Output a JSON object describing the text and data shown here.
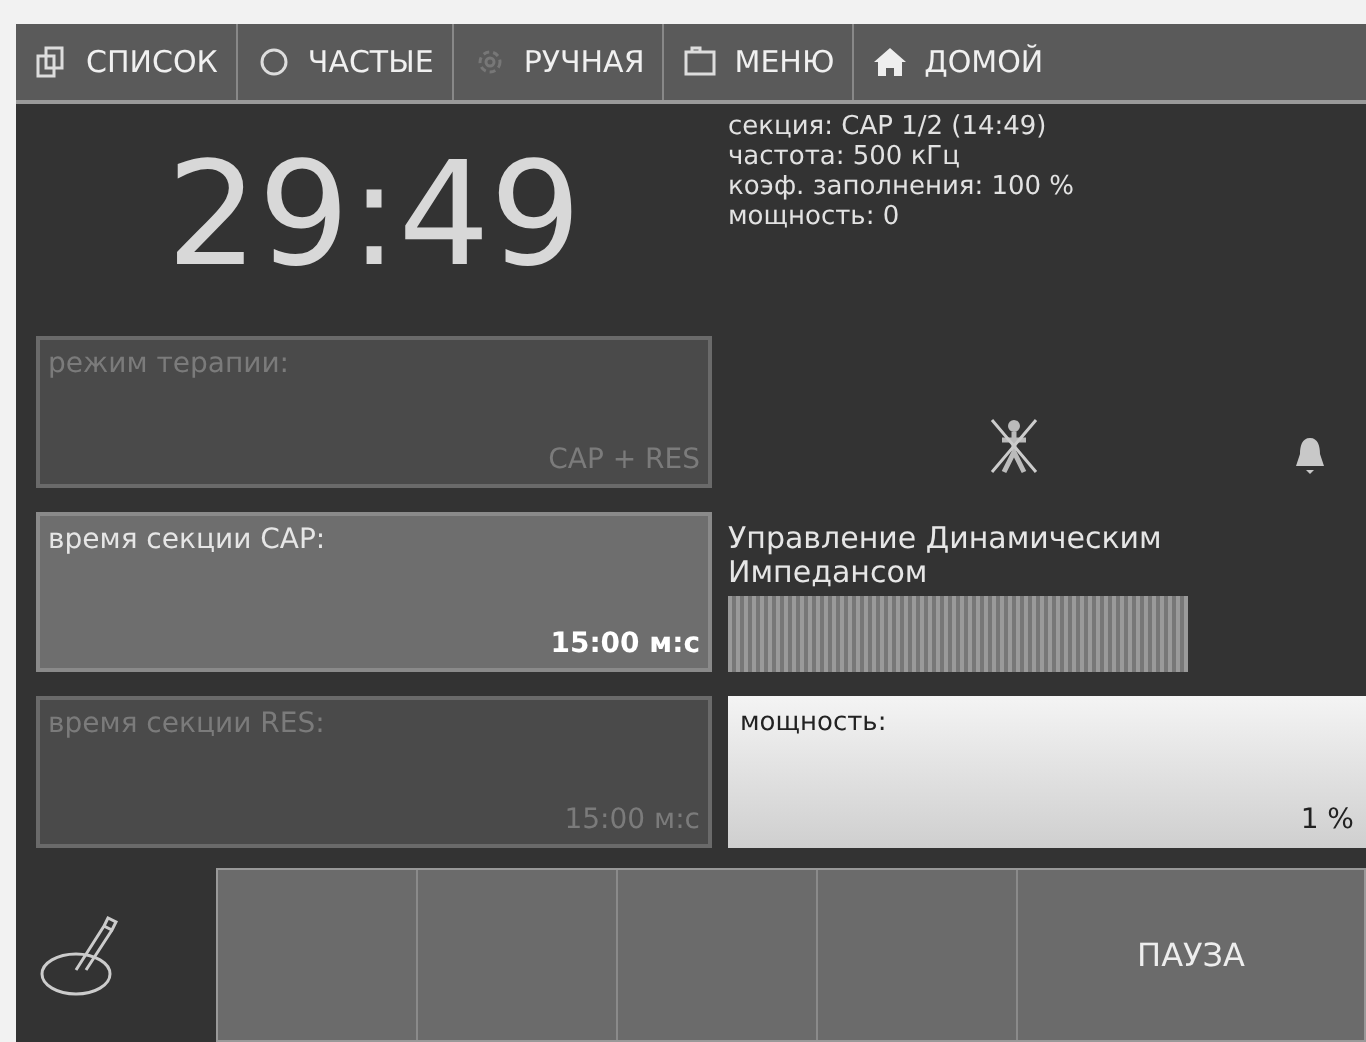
{
  "toolbar": [
    {
      "label": "СПИСОК",
      "kind": "list"
    },
    {
      "label": "ЧАСТЫЕ",
      "kind": "favorites"
    },
    {
      "label": "РУЧНАЯ",
      "kind": "manual"
    },
    {
      "label": "МЕНЮ",
      "kind": "menu"
    },
    {
      "label": "ДОМОЙ",
      "kind": "home"
    }
  ],
  "timer": "29:49",
  "info": [
    "секция: CAP 1/2 (14:49)",
    "частота: 500 кГц",
    "коэф. заполнения: 100 %",
    "мощность: 0"
  ],
  "panels": [
    {
      "label": "режим терапии:",
      "value": "CAP + RES",
      "disabled": true
    },
    {
      "label": "время секции CAP:",
      "value": "15:00 м:с",
      "disabled": false
    },
    {
      "label": "время секции RES:",
      "value": "15:00 м:с",
      "disabled": true
    }
  ],
  "impedance": {
    "title": "Управление Динамическим Импедансом"
  },
  "power": {
    "label": "мощность:",
    "value": "1 %"
  },
  "pause": {
    "label": "ПАУЗА"
  }
}
